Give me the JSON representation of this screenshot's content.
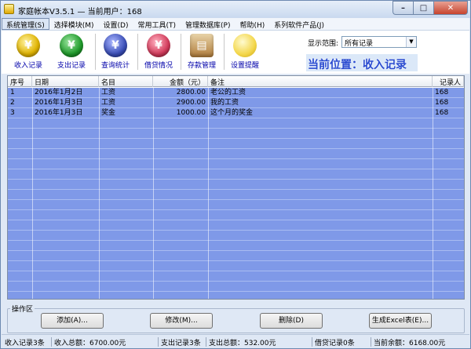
{
  "window": {
    "title": "家庭帐本V3.5.1  —  当前用户：168"
  },
  "menu": [
    {
      "label": "系统管理(S)"
    },
    {
      "label": "选择模块(M)"
    },
    {
      "label": "设置(D)"
    },
    {
      "label": "常用工具(T)"
    },
    {
      "label": "管理数据库(P)"
    },
    {
      "label": "帮助(H)"
    },
    {
      "label": "系列软件产品(J)"
    }
  ],
  "toolbar": {
    "items": [
      {
        "label": "收入记录",
        "icon": "yen-coin-add-icon",
        "color": "#e0b300"
      },
      {
        "label": "支出记录",
        "icon": "yen-coin-out-icon",
        "color": "#1f9a2a"
      },
      {
        "label": "查询统计",
        "icon": "yen-coin-search-icon",
        "color": "#3b4fb8"
      },
      {
        "label": "借贷情况",
        "icon": "yen-coin-loan-icon",
        "color": "#d23a5a"
      },
      {
        "label": "存款管理",
        "icon": "deposit-box-icon",
        "color": "#b07c3a"
      },
      {
        "label": "设置提醒",
        "icon": "lightbulb-icon",
        "color": "#f3d64a"
      }
    ],
    "range_label": "显示范围:",
    "range_value": "所有记录",
    "location": "当前位置：收入记录"
  },
  "table": {
    "columns": [
      "序号",
      "日期",
      "名目",
      "金额（元）",
      "备注",
      "记录人"
    ],
    "rows": [
      {
        "no": "1",
        "date": "2016年1月2日",
        "item": "工资",
        "amount": "2800.00",
        "note": "老公的工资",
        "recorder": "168"
      },
      {
        "no": "2",
        "date": "2016年1月3日",
        "item": "工资",
        "amount": "2900.00",
        "note": "我的工资",
        "recorder": "168"
      },
      {
        "no": "3",
        "date": "2016年1月3日",
        "item": "奖金",
        "amount": "1000.00",
        "note": "这个月的奖金",
        "recorder": "168"
      }
    ]
  },
  "operation": {
    "legend": "操作区",
    "add": "添加(A)...",
    "edit": "修改(M)...",
    "delete": "删除(D)",
    "excel": "生成Excel表(E)..."
  },
  "status": {
    "income_count": "收入记录3条",
    "income_total": "收入总额：6700.00元",
    "expense_count": "支出记录3条",
    "expense_total": "支出总额：532.00元",
    "loan_count": "借贷记录0条",
    "balance": "当前余额：6168.00元"
  }
}
